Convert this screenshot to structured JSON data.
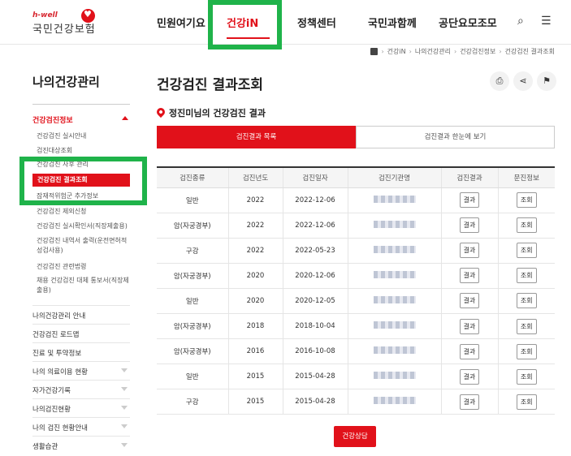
{
  "logo": {
    "small": "h-well",
    "main": "국민건강보험"
  },
  "nav": [
    "민원여기요",
    "건강iN",
    "정책센터",
    "국민과함께",
    "공단요모조모"
  ],
  "breadcrumb": [
    "건강iN",
    "나의건강관리",
    "건강검진정보",
    "건강검진 결과조회"
  ],
  "sidebar": {
    "title": "나의건강관리",
    "category": "건강검진정보",
    "subs": [
      "건강검진 실시안내",
      "검진대상조회",
      "건강검진 사후 관리",
      "건강검진 결과조회",
      "잠재적위험군 추가정보",
      "건강검진 제외신청",
      "건강검진 실시확인서(직장제출용)",
      "건강검진 내역서 출력(운전면허적성검사용)",
      "건강검진 관련법령",
      "채용 건강검진 대체 통보서(직장제출용)"
    ],
    "main_items": [
      "나의건강관리 안내",
      "건강검진 로드맵",
      "진료 및 투약정보",
      "나의 의료이용 현황",
      "자가건강기록",
      "나의검진현황",
      "나의 검진 현황안내",
      "생활습관"
    ]
  },
  "page_title": "건강검진 결과조회",
  "sub_heading": "정진미님의 건강검진 결과",
  "tabs": [
    "검진결과 목록",
    "검진결과 한눈에 보기"
  ],
  "table": {
    "headers": [
      "검진종류",
      "검진년도",
      "검진일자",
      "검진기관명",
      "검진결과",
      "문진정보"
    ],
    "rows": [
      [
        "일반",
        "2022",
        "2022-12-06"
      ],
      [
        "암(자궁경부)",
        "2022",
        "2022-12-06"
      ],
      [
        "구강",
        "2022",
        "2022-05-23"
      ],
      [
        "암(자궁경부)",
        "2020",
        "2020-12-06"
      ],
      [
        "일반",
        "2020",
        "2020-12-05"
      ],
      [
        "암(자궁경부)",
        "2018",
        "2018-10-04"
      ],
      [
        "암(자궁경부)",
        "2016",
        "2016-10-08"
      ],
      [
        "일반",
        "2015",
        "2015-04-28"
      ],
      [
        "구강",
        "2015",
        "2015-04-28"
      ]
    ],
    "result_btn": "결과",
    "interview_btn": "조회"
  },
  "consult_btn": "건강상담"
}
